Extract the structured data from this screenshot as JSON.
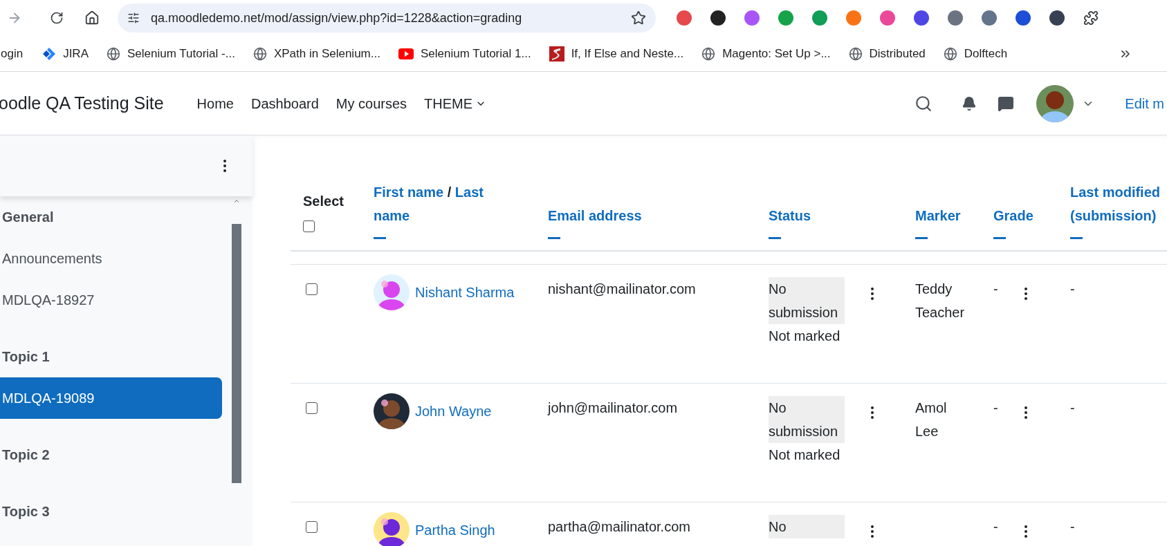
{
  "browser": {
    "url": "qa.moodledemo.net/mod/assign/view.php?id=1228&action=grading",
    "bookmarks": [
      {
        "kind": "none",
        "label": "ogin"
      },
      {
        "kind": "jira",
        "label": "JIRA"
      },
      {
        "kind": "globe",
        "label": "Selenium Tutorial -..."
      },
      {
        "kind": "globe",
        "label": "XPath in Selenium..."
      },
      {
        "kind": "video",
        "label": "Selenium Tutorial 1..."
      },
      {
        "kind": "letter",
        "label": "If, If Else and Neste..."
      },
      {
        "kind": "globe",
        "label": "Magento: Set Up >..."
      },
      {
        "kind": "globe",
        "label": "Distributed"
      },
      {
        "kind": "globe",
        "label": "Dolftech"
      }
    ]
  },
  "header": {
    "site_name": "oodle QA Testing Site",
    "nav": [
      {
        "label": "Home",
        "dropdown": false
      },
      {
        "label": "Dashboard",
        "dropdown": false
      },
      {
        "label": "My courses",
        "dropdown": false
      },
      {
        "label": "THEME",
        "dropdown": true
      }
    ],
    "edit_link": "Edit m"
  },
  "sidebar": {
    "items": [
      {
        "kind": "section",
        "label": "General",
        "selected": false
      },
      {
        "kind": "item",
        "label": "Announcements",
        "selected": false
      },
      {
        "kind": "item",
        "label": "MDLQA-18927",
        "selected": false
      },
      {
        "kind": "section",
        "label": "Topic 1",
        "selected": false
      },
      {
        "kind": "item",
        "label": "MDLQA-19089",
        "selected": true
      },
      {
        "kind": "section",
        "label": "Topic 2",
        "selected": false
      },
      {
        "kind": "section",
        "label": "Topic 3",
        "selected": false
      }
    ]
  },
  "table": {
    "select_label": "Select",
    "select_all_checked": false,
    "name_header": {
      "first": "First name",
      "separator": "/",
      "last": "Last name"
    },
    "columns": [
      "Email address",
      "Status",
      "Marker",
      "Grade",
      "Last modified (submission)"
    ],
    "rows": [
      {
        "checked": false,
        "name": "Nishant Sharma",
        "email": "nishant@mailinator.com",
        "status": "No submission",
        "grading": "Not marked",
        "marker": "Teddy Teacher",
        "grade": "-",
        "modified": "-"
      },
      {
        "checked": false,
        "name": "John Wayne",
        "email": "john@mailinator.com",
        "status": "No submission",
        "grading": "Not marked",
        "marker": "Amol Lee",
        "grade": "-",
        "modified": "-"
      },
      {
        "checked": false,
        "name": "Partha Singh",
        "email": "partha@mailinator.com",
        "status": "No",
        "grade": "-",
        "modified": "-"
      }
    ]
  }
}
